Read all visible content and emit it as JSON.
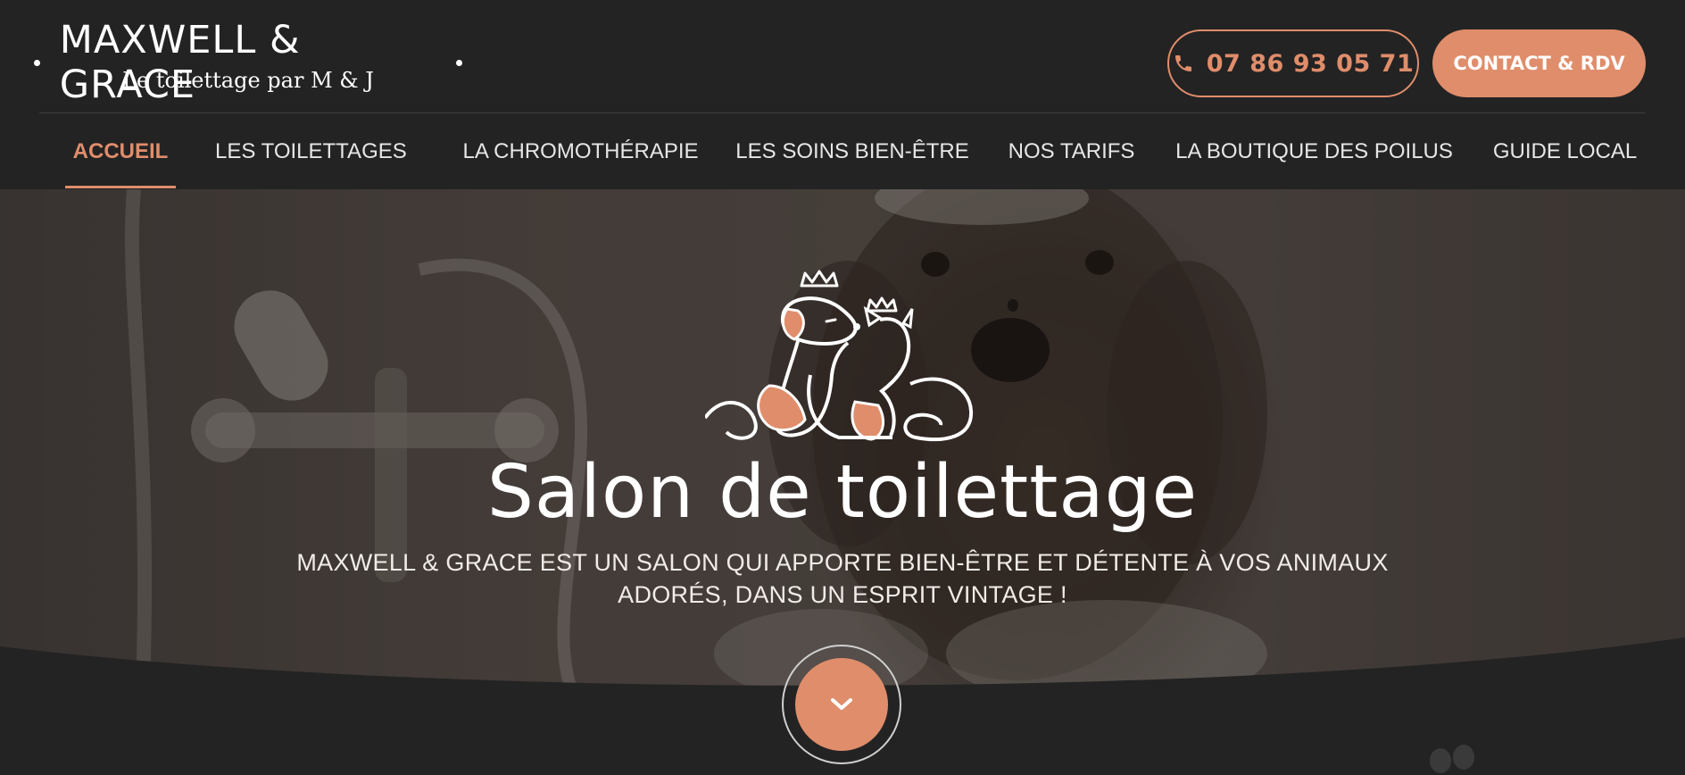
{
  "brand": {
    "name": "MAXWELL & GRACE",
    "tagline": "Le toilettage par M & J"
  },
  "header": {
    "phone": "07 86 93 05 71",
    "contact_label": "CONTACT & RDV"
  },
  "nav": {
    "items": [
      {
        "label": "ACCUEIL",
        "active": true
      },
      {
        "label": "LES TOILETTAGES",
        "has_submenu": true
      },
      {
        "label": "LA CHROMOTHÉRAPIE"
      },
      {
        "label": "LES SOINS BIEN-ÊTRE"
      },
      {
        "label": "NOS TARIFS"
      },
      {
        "label": "LA BOUTIQUE DES POILUS"
      },
      {
        "label": "GUIDE LOCAL"
      }
    ]
  },
  "hero": {
    "title": "Salon de toilettage",
    "subtitle_line1": "MAXWELL & GRACE EST UN SALON QUI APPORTE BIEN-ÊTRE ET DÉTENTE À VOS ANIMAUX",
    "subtitle_line2": "ADORÉS, DANS UN ESPRIT VINTAGE !"
  },
  "icons": {
    "phone": "phone-icon",
    "submenu": "chevron-down-icon",
    "scroll": "chevron-down-icon",
    "emblem": "dog-cat-crown-logo"
  },
  "colors": {
    "accent": "#e08d6b",
    "background": "#232323",
    "text": "#ffffff"
  }
}
